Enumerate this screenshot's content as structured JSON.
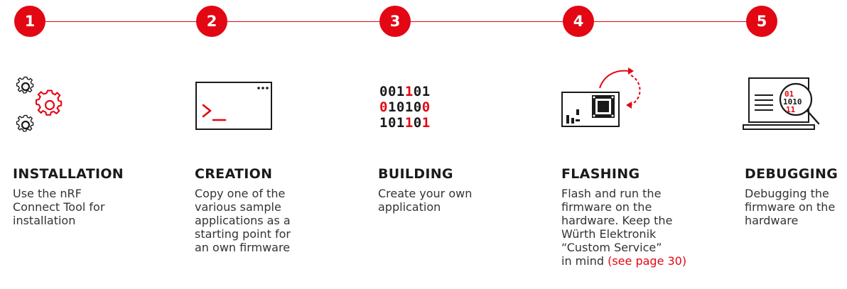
{
  "colors": {
    "accent": "#e30613",
    "text": "#222222"
  },
  "steps": [
    {
      "number": "1",
      "title": "INSTALLATION",
      "icon": "gears-icon",
      "desc": [
        "Use the nRF",
        "Connect Tool for",
        "installation"
      ]
    },
    {
      "number": "2",
      "title": "CREATION",
      "icon": "terminal-window-icon",
      "desc": [
        "Copy one of the",
        "various sample",
        "applications as a",
        "starting point for",
        "an own firmware"
      ]
    },
    {
      "number": "3",
      "title": "BUILDING",
      "icon": "binary-code-icon",
      "desc": [
        "Create your own",
        "application"
      ],
      "binary_rows": [
        [
          "001",
          "1",
          "01"
        ],
        [
          "0",
          "1010",
          "",
          "0"
        ],
        [
          "101",
          "1",
          "0",
          "1"
        ]
      ]
    },
    {
      "number": "4",
      "title": "FLASHING",
      "icon": "flash-board-icon",
      "desc": [
        "Flash and run the",
        "firmware on the",
        "hardware. Keep the",
        "Würth Elektronik",
        "“Custom Service”"
      ],
      "desc_last_plain": "in mind ",
      "desc_last_link": "(see page 30)"
    },
    {
      "number": "5",
      "title": "DEBUGGING",
      "icon": "laptop-magnifier-icon",
      "desc": [
        "Debugging the",
        "firmware on the",
        "hardware"
      ]
    }
  ]
}
